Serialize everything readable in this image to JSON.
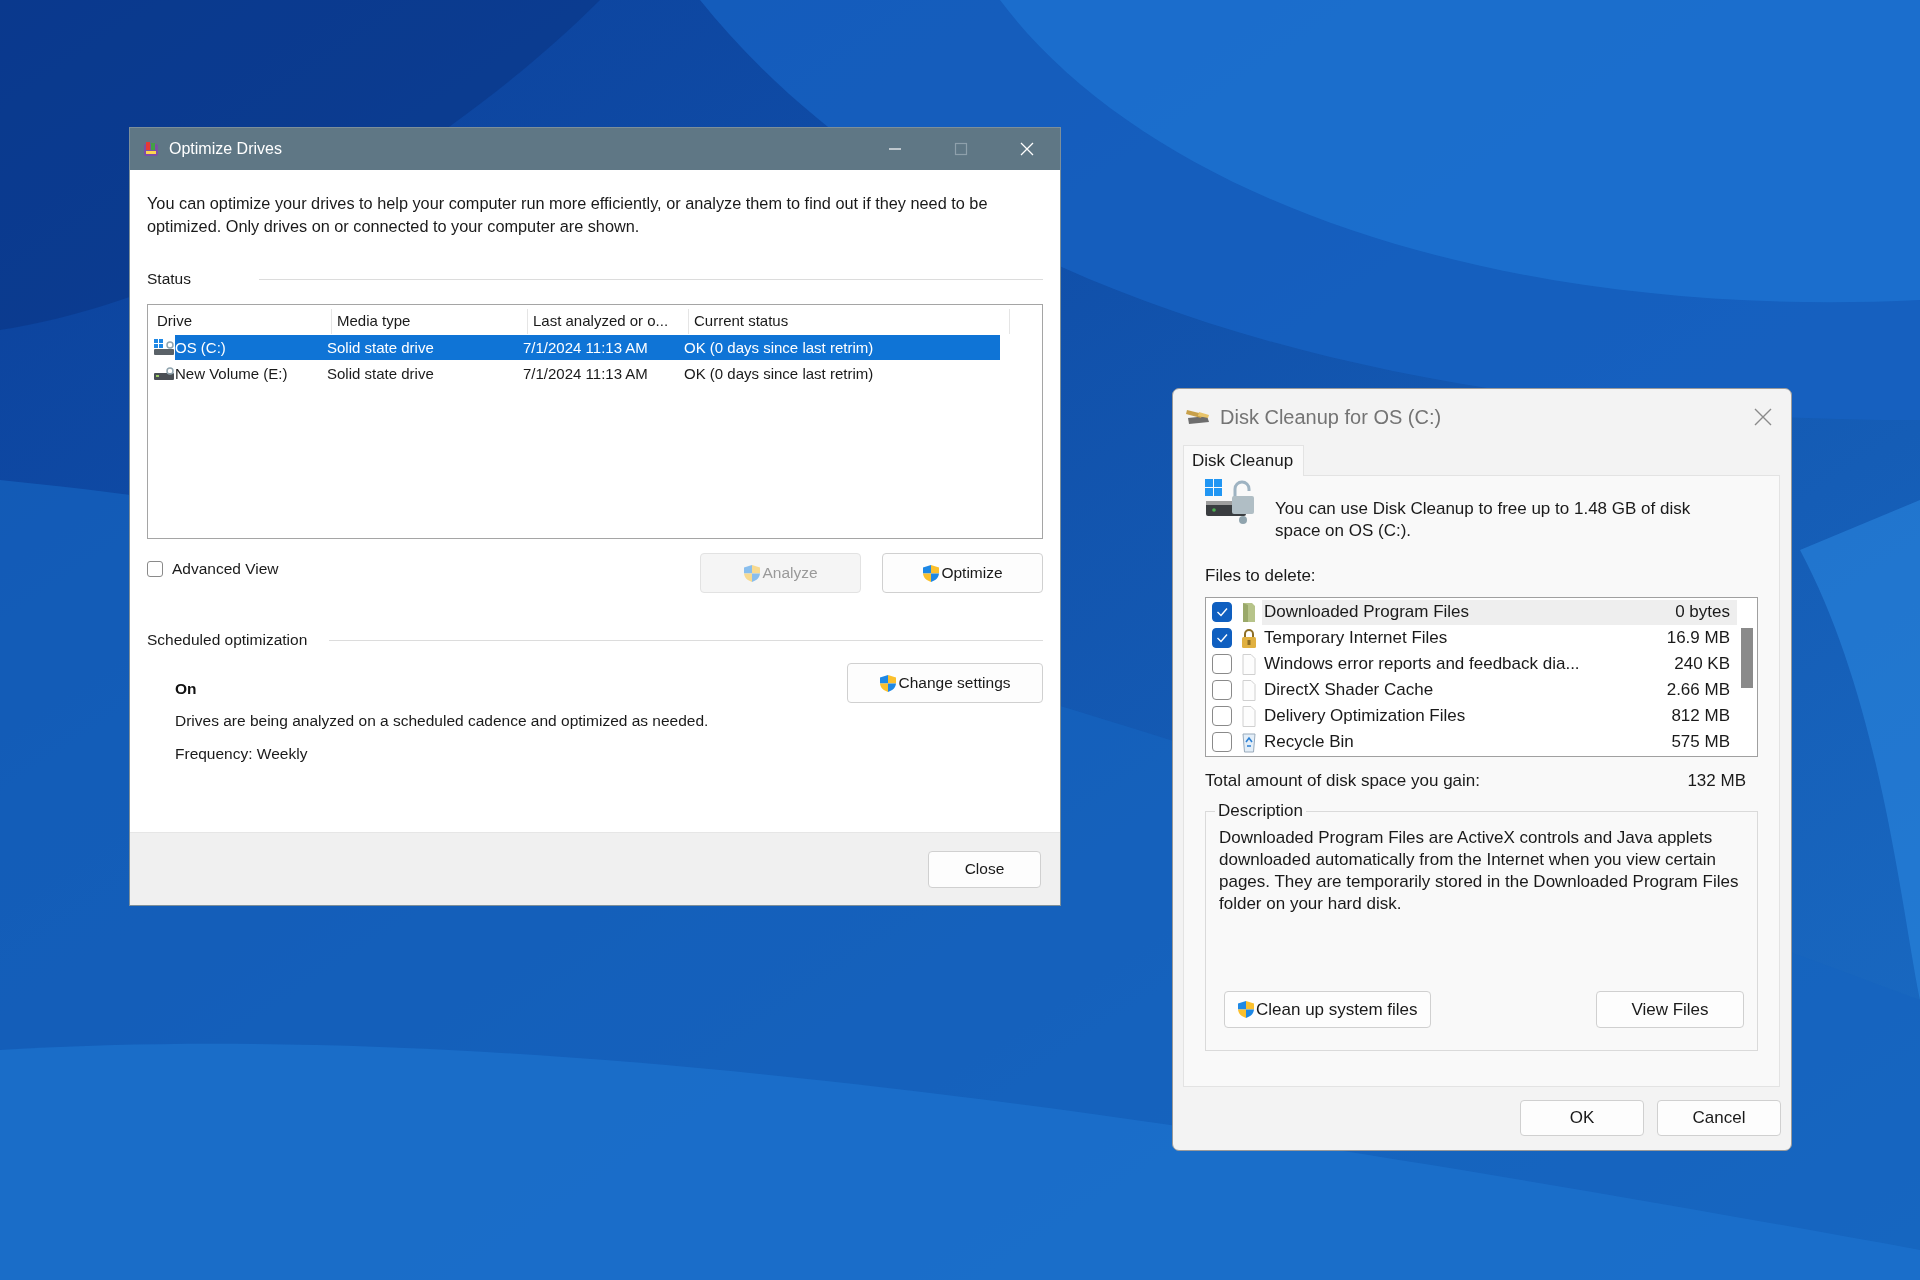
{
  "optimize_drives": {
    "title": "Optimize Drives",
    "intro": "You can optimize your drives to help your computer run more efficiently, or analyze them to find out if they need to be optimized. Only drives on or connected to your computer are shown.",
    "status_label": "Status",
    "columns": [
      "Drive",
      "Media type",
      "Last analyzed or o...",
      "Current status"
    ],
    "drives": [
      {
        "kind": "system",
        "drive": "OS (C:)",
        "media_type": "Solid state drive",
        "last_analyzed": "7/1/2024 11:13 AM",
        "current_status": "OK (0 days since last retrim)",
        "selected": true
      },
      {
        "kind": "volume",
        "drive": "New Volume (E:)",
        "media_type": "Solid state drive",
        "last_analyzed": "7/1/2024 11:13 AM",
        "current_status": "OK (0 days since last retrim)",
        "selected": false
      }
    ],
    "advanced_view": {
      "label": "Advanced View",
      "checked": false
    },
    "actions": [
      {
        "label": "Analyze",
        "shield": true,
        "disabled": true
      },
      {
        "label": "Optimize",
        "shield": true,
        "disabled": false
      }
    ],
    "scheduled": {
      "heading": "Scheduled optimization",
      "state": "On",
      "description": "Drives are being analyzed on a scheduled cadence and optimized as needed.",
      "frequency": "Frequency: Weekly",
      "button": {
        "label": "Change settings",
        "shield": true
      }
    },
    "close_button": "Close"
  },
  "disk_cleanup": {
    "title": "Disk Cleanup for OS (C:)",
    "tab": "Disk Cleanup",
    "summary": "You can use Disk Cleanup to free up to 1.48 GB of disk space on OS (C:).",
    "files_label": "Files to delete:",
    "files": [
      {
        "kind": "folder",
        "name": "Downloaded Program Files",
        "size": "0 bytes",
        "checked": true,
        "selected": true
      },
      {
        "kind": "lock",
        "name": "Temporary Internet Files",
        "size": "16.9 MB",
        "checked": true,
        "selected": false
      },
      {
        "kind": "page",
        "name": "Windows error reports and feedback dia...",
        "size": "240 KB",
        "checked": false,
        "selected": false
      },
      {
        "kind": "page",
        "name": "DirectX Shader Cache",
        "size": "2.66 MB",
        "checked": false,
        "selected": false
      },
      {
        "kind": "page",
        "name": "Delivery Optimization Files",
        "size": "812 MB",
        "checked": false,
        "selected": false
      },
      {
        "kind": "recycle",
        "name": "Recycle Bin",
        "size": "575 MB",
        "checked": false,
        "selected": false
      }
    ],
    "total_label": "Total amount of disk space you gain:",
    "total_value": "132 MB",
    "description_label": "Description",
    "description": "Downloaded Program Files are ActiveX controls and Java applets downloaded automatically from the Internet when you view certain pages. They are temporarily stored in the Downloaded Program Files folder on your hard disk.",
    "buttons": [
      {
        "label": "Clean up system files",
        "shield": true
      },
      {
        "label": "View Files"
      }
    ],
    "dialog_buttons": [
      "OK",
      "Cancel"
    ]
  }
}
